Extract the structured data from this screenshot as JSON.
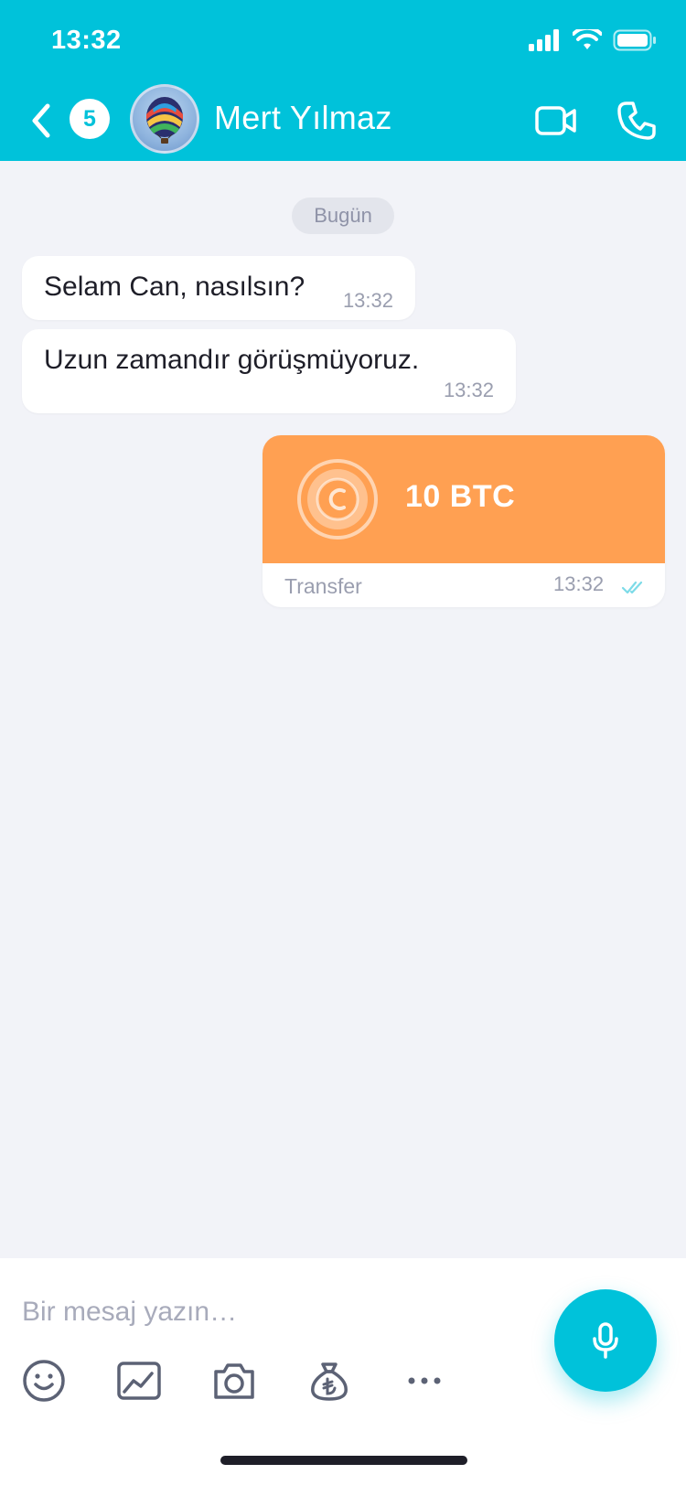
{
  "status_bar": {
    "time": "13:32"
  },
  "header": {
    "unread_count": "5",
    "contact_name": "Mert Yılmaz"
  },
  "chat": {
    "date_label": "Bugün",
    "messages": [
      {
        "text": "Selam Can, nasılsın?",
        "time": "13:32"
      },
      {
        "text": "Uzun zamandır görüşmüyoruz.",
        "time": "13:32"
      }
    ],
    "transfer": {
      "amount": "10 BTC",
      "label": "Transfer",
      "time": "13:32"
    }
  },
  "composer": {
    "placeholder": "Bir mesaj yazın…"
  },
  "colors": {
    "accent": "#00C2DA",
    "transfer": "#FFA052",
    "background": "#F2F3F8"
  }
}
